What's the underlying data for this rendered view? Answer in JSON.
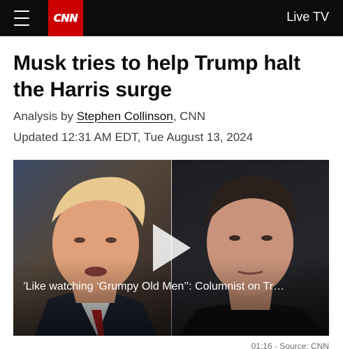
{
  "nav": {
    "logo_text": "CNN",
    "live_tv_label": "Live TV",
    "brand_color": "#cc0000"
  },
  "article": {
    "headline": "Musk tries to help Trump halt the Harris surge",
    "byline_prefix": "Analysis by ",
    "author": "Stephen Collinson",
    "byline_suffix": ", CNN",
    "updated": "Updated 12:31 AM EDT, Tue August 13, 2024"
  },
  "video": {
    "caption": "’Like watching ‘Grumpy Old Men’’: Columnist on Tr…",
    "duration_source": "01:16 - Source: CNN",
    "play_icon": "play-icon"
  }
}
